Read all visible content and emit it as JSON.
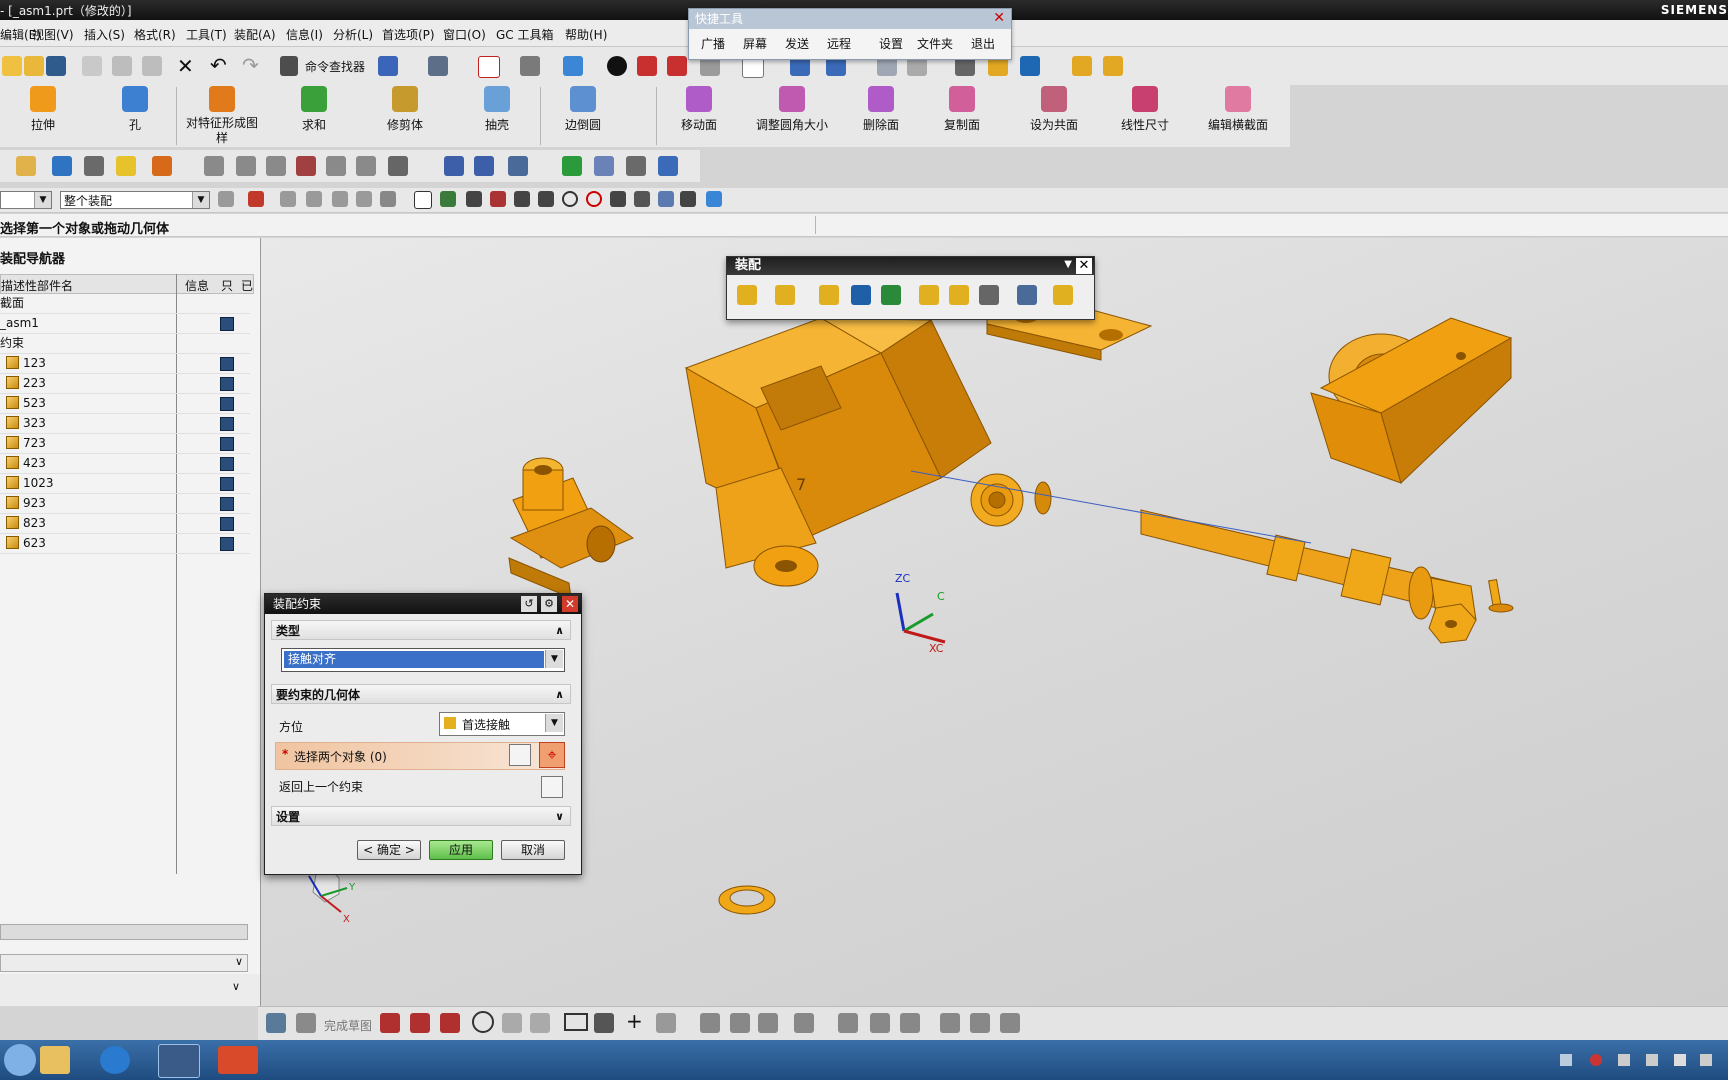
{
  "window": {
    "title": "- [_asm1.prt（修改的）]",
    "brand": "SIEMENS"
  },
  "menu": [
    "编辑(E)",
    "视图(V)",
    "插入(S)",
    "格式(R)",
    "工具(T)",
    "装配(A)",
    "信息(I)",
    "分析(L)",
    "首选项(P)",
    "窗口(O)",
    "GC 工具箱",
    "帮助(H)"
  ],
  "toolbar": {
    "command_finder": "命令查找器"
  },
  "quick_tools": {
    "title": "快捷工具",
    "buttons": [
      "广播",
      "屏幕",
      "发送",
      "远程",
      "设置",
      "文件夹",
      "退出"
    ]
  },
  "feature_bar": {
    "items": [
      "拉伸",
      "孔",
      "对特征形成图样",
      "求和",
      "修剪体",
      "抽壳",
      "边倒圆",
      "移动面",
      "调整圆角大小",
      "删除面",
      "复制面",
      "设为共面",
      "线性尺寸",
      "编辑横截面"
    ]
  },
  "selection": {
    "filter_value": "",
    "scope_value": "整个装配"
  },
  "cue_line": "选择第一个对象或拖动几何体",
  "navigator": {
    "title": "装配导航器",
    "columns": [
      "描述性部件名",
      "信息",
      "只",
      "已"
    ],
    "root_rows": [
      "截面",
      "_asm1",
      "约束"
    ],
    "parts": [
      "123",
      "223",
      "523",
      "323",
      "723",
      "423",
      "1023",
      "923",
      "823",
      "623"
    ]
  },
  "assembly_toolbar": {
    "title": "装配"
  },
  "dialog": {
    "title": "装配约束",
    "type_section": "类型",
    "type_value": "接触对齐",
    "geometry_section": "要约束的几何体",
    "orientation_label": "方位",
    "orientation_value": "首选接触",
    "select_label": "选择两个对象 (0)",
    "back_label": "返回上一个约束",
    "settings_section": "设置",
    "ok": "< 确定 >",
    "apply": "应用",
    "cancel": "取消"
  },
  "axes": {
    "zc": "ZC",
    "xc": "XC",
    "yc": "C",
    "tri_z": "Z",
    "tri_y": "Y",
    "tri_x": "X"
  },
  "sketch_bar": {
    "finish_sketch": "完成草图"
  },
  "colors": {
    "part": "#f0a010",
    "part_dark": "#b46f00",
    "dialog_header": "#1a1a1a",
    "apply": "#5fbf4a"
  }
}
